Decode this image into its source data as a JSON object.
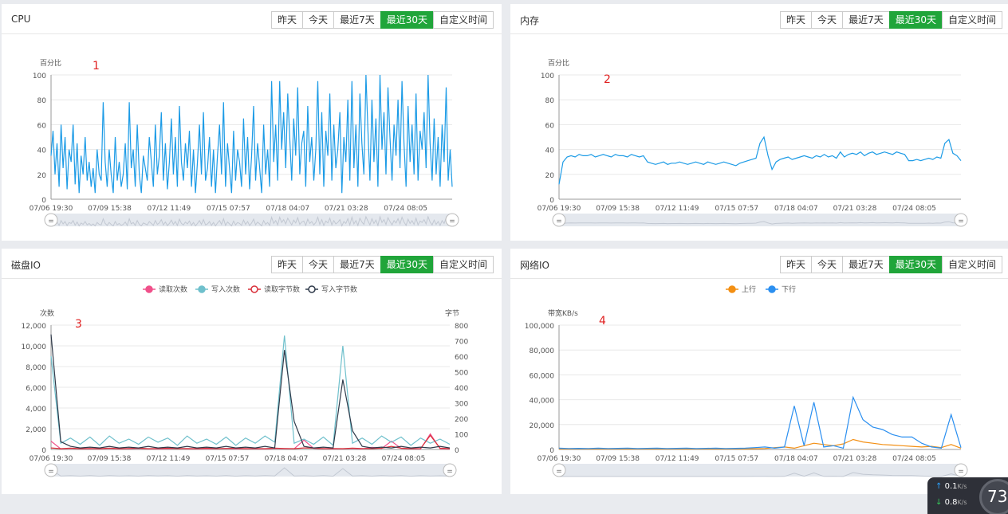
{
  "range_buttons": [
    "昨天",
    "今天",
    "最近7天",
    "最近30天",
    "自定义时间"
  ],
  "active_button": "最近30天",
  "x_ticks": [
    "07/06 19:30",
    "07/09 15:38",
    "07/12 11:49",
    "07/15 07:57",
    "07/18 04:07",
    "07/21 03:28",
    "07/24 08:05"
  ],
  "panels": [
    {
      "id": "cpu",
      "title": "CPU",
      "marker": "1",
      "ylabel": "百分比",
      "yticks": [
        "0",
        "20",
        "40",
        "60",
        "80",
        "100"
      ]
    },
    {
      "id": "mem",
      "title": "内存",
      "marker": "2",
      "ylabel": "百分比",
      "yticks": [
        "0",
        "20",
        "40",
        "60",
        "80",
        "100"
      ]
    },
    {
      "id": "disk",
      "title": "磁盘IO",
      "marker": "3",
      "ylabel": "次数",
      "ylabel_right": "字节",
      "yticks": [
        "0",
        "2,000",
        "4,000",
        "6,000",
        "8,000",
        "10,000",
        "12,000"
      ],
      "yticks_right": [
        "0",
        "100",
        "200",
        "300",
        "400",
        "500",
        "600",
        "700",
        "800"
      ],
      "legend": [
        "读取次数",
        "写入次数",
        "读取字节数",
        "写入字节数"
      ]
    },
    {
      "id": "net",
      "title": "网络IO",
      "marker": "4",
      "ylabel": "带宽KB/s",
      "yticks": [
        "0",
        "20,000",
        "40,000",
        "60,000",
        "80,000",
        "100,000"
      ],
      "legend": [
        "上行",
        "下行"
      ]
    }
  ],
  "colors": {
    "cpu_line": "#1c9be6",
    "mem_line": "#1c9be6",
    "read_count": "#f0508a",
    "write_count": "#6fc0cc",
    "read_bytes": "#d9303a",
    "write_bytes": "#2f3a4a",
    "up": "#f38f13",
    "down": "#2b8ff0",
    "active_btn": "#20a53a"
  },
  "chart_data": [
    {
      "type": "line",
      "title": "CPU",
      "ylabel": "百分比",
      "ylim": [
        0,
        100
      ],
      "series": [
        {
          "values": [
            35,
            55,
            20,
            45,
            10,
            60,
            25,
            50,
            8,
            40,
            30,
            60,
            12,
            45,
            5,
            35,
            20,
            50,
            15,
            30,
            10,
            25,
            5,
            40,
            20,
            15,
            78,
            30,
            10,
            40,
            20,
            5,
            50,
            15,
            30,
            10,
            20,
            45,
            8,
            78,
            25,
            40,
            10,
            60,
            20,
            5,
            35,
            25,
            15,
            50,
            30,
            10,
            60,
            20,
            35,
            70,
            15,
            45,
            8,
            30,
            65,
            20,
            50,
            10,
            75,
            30,
            15,
            45,
            25,
            55,
            10,
            40,
            5,
            30,
            60,
            20,
            70,
            15,
            25,
            50,
            10,
            40,
            5,
            35,
            60,
            20,
            78,
            10,
            45,
            25,
            5,
            55,
            15,
            40,
            30,
            10,
            65,
            20,
            50,
            8,
            35,
            75,
            15,
            45,
            25,
            5,
            60,
            20,
            40,
            10,
            95,
            30,
            60,
            15,
            95,
            40,
            70,
            25,
            85,
            50,
            15,
            65,
            35,
            90,
            20,
            45,
            55,
            10,
            75,
            30,
            50,
            15,
            40,
            95,
            20,
            70,
            10,
            55,
            35,
            85,
            15,
            60,
            25,
            40,
            70,
            5,
            50,
            30,
            80,
            15,
            95,
            25,
            60,
            10,
            85,
            45,
            20,
            100,
            55,
            15,
            80,
            30,
            65,
            10,
            100,
            40,
            70,
            20,
            90,
            50,
            15,
            60,
            35,
            80,
            25,
            95,
            45,
            10,
            75,
            30,
            60,
            20,
            85,
            15,
            55,
            40,
            70,
            25,
            100,
            45,
            15,
            65,
            20,
            50,
            10,
            60,
            30,
            90,
            15,
            40,
            10
          ]
        }
      ]
    },
    {
      "type": "line",
      "title": "内存",
      "ylabel": "百分比",
      "ylim": [
        0,
        100
      ],
      "series": [
        {
          "values": [
            12,
            30,
            34,
            35,
            34,
            36,
            35,
            35,
            36,
            34,
            35,
            36,
            35,
            34,
            36,
            35,
            35,
            34,
            36,
            35,
            34,
            35,
            30,
            29,
            28,
            29,
            30,
            28,
            29,
            29,
            30,
            29,
            28,
            29,
            30,
            29,
            28,
            30,
            29,
            28,
            29,
            30,
            29,
            28,
            27,
            29,
            30,
            31,
            32,
            33,
            45,
            50,
            35,
            24,
            30,
            32,
            33,
            34,
            32,
            33,
            34,
            35,
            34,
            33,
            35,
            34,
            36,
            34,
            35,
            33,
            38,
            34,
            36,
            37,
            36,
            38,
            35,
            37,
            38,
            36,
            37,
            38,
            37,
            36,
            38,
            37,
            36,
            31,
            31,
            32,
            31,
            32,
            33,
            32,
            34,
            33,
            45,
            48,
            37,
            35,
            31
          ]
        }
      ]
    },
    {
      "type": "line",
      "title": "磁盘IO",
      "ylabel": "次数",
      "ylim": [
        0,
        12000
      ],
      "ylim_right": [
        0,
        800
      ],
      "series": [
        {
          "name": "读取次数",
          "values": [
            800,
            50,
            100,
            60,
            80,
            50,
            100,
            50,
            80,
            100,
            60,
            50,
            80,
            100,
            60,
            50,
            80,
            60,
            100,
            50,
            80,
            60,
            50,
            100,
            80,
            60,
            900,
            100,
            80,
            50,
            60,
            100,
            50,
            200,
            100,
            800,
            100,
            60,
            50,
            1500,
            80,
            50
          ]
        },
        {
          "name": "写入次数",
          "values": [
            9000,
            600,
            1100,
            500,
            1200,
            400,
            1300,
            600,
            1000,
            500,
            1200,
            700,
            1100,
            400,
            1300,
            600,
            1000,
            500,
            1200,
            400,
            1100,
            600,
            1300,
            700,
            11000,
            600,
            1000,
            500,
            1200,
            400,
            10000,
            600,
            1100,
            500,
            1300,
            700,
            1200,
            400,
            1100,
            600,
            1000,
            500
          ]
        },
        {
          "name": "读取字节数",
          "values": [
            10,
            5,
            8,
            5,
            6,
            5,
            8,
            5,
            6,
            8,
            5,
            6,
            8,
            5,
            6,
            5,
            8,
            5,
            6,
            8,
            5,
            6,
            5,
            8,
            6,
            5,
            10,
            8,
            5,
            6,
            5,
            8,
            6,
            5,
            8,
            20,
            8,
            5,
            6,
            90,
            8,
            5
          ]
        },
        {
          "name": "写入字节数",
          "values": [
            740,
            50,
            20,
            10,
            15,
            10,
            20,
            10,
            15,
            10,
            20,
            10,
            15,
            10,
            20,
            10,
            15,
            10,
            20,
            10,
            15,
            10,
            20,
            10,
            640,
            180,
            20,
            10,
            15,
            10,
            450,
            120,
            20,
            10,
            15,
            10,
            20,
            10,
            15,
            10,
            20,
            10
          ]
        }
      ]
    },
    {
      "type": "line",
      "title": "网络IO",
      "ylabel": "带宽KB/s",
      "ylim": [
        0,
        100000
      ],
      "series": [
        {
          "name": "上行",
          "values": [
            500,
            400,
            500,
            400,
            500,
            400,
            500,
            400,
            500,
            400,
            500,
            400,
            500,
            400,
            500,
            400,
            500,
            400,
            500,
            400,
            600,
            800,
            1500,
            2000,
            1000,
            3000,
            5000,
            4000,
            3000,
            4500,
            8000,
            6000,
            5000,
            4000,
            3500,
            3000,
            2500,
            2000,
            2500,
            1500,
            4000,
            1000
          ]
        },
        {
          "name": "下行",
          "values": [
            1000,
            800,
            900,
            800,
            1000,
            800,
            900,
            1000,
            800,
            900,
            1000,
            800,
            900,
            1000,
            800,
            900,
            1000,
            800,
            900,
            1000,
            1500,
            2000,
            1000,
            2000,
            35000,
            3000,
            38000,
            2000,
            3000,
            1000,
            42000,
            24000,
            18000,
            16000,
            12000,
            10000,
            10000,
            5000,
            2000,
            1000,
            28000,
            1500
          ]
        }
      ]
    }
  ],
  "widget": {
    "up": "0.1",
    "down": "0.8",
    "unit": "K/s",
    "gauge": "73"
  }
}
